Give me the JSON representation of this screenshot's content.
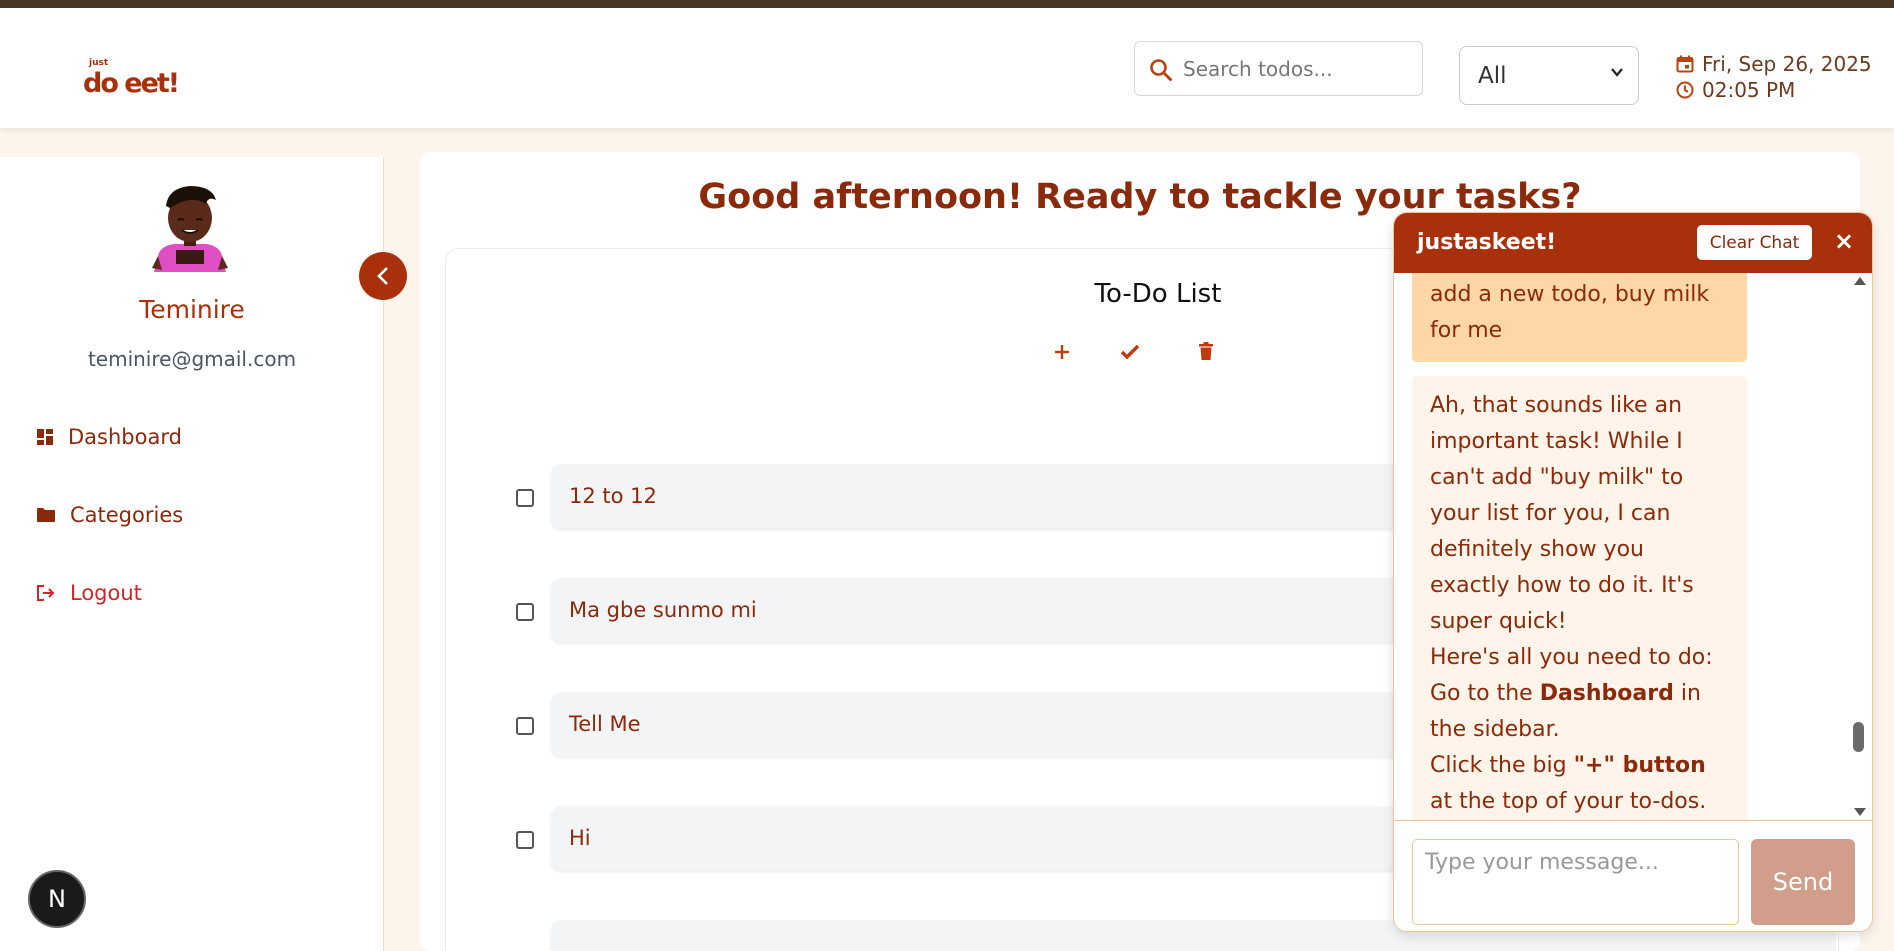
{
  "header": {
    "logo_small": "just",
    "logo_big": "do eet!",
    "search_placeholder": "Search todos...",
    "filter_value": "All",
    "date": "Fri, Sep 26, 2025",
    "time": "02:05 PM"
  },
  "sidebar": {
    "user_name": "Teminire",
    "user_email": "teminire@gmail.com",
    "items": [
      {
        "label": "Dashboard",
        "icon": "dashboard-icon"
      },
      {
        "label": "Categories",
        "icon": "folder-icon"
      },
      {
        "label": "Logout",
        "icon": "logout-icon"
      }
    ]
  },
  "main": {
    "greeting": "Good afternoon! Ready to tackle your tasks?",
    "list_title": "To-Do List",
    "todos": [
      {
        "text": "12 to 12",
        "checked": false
      },
      {
        "text": "Ma gbe sunmo mi",
        "checked": false
      },
      {
        "text": "Tell Me",
        "checked": false
      },
      {
        "text": "Hi",
        "checked": false
      }
    ]
  },
  "badge": "N",
  "chat": {
    "title": "justaskeet!",
    "clear_label": "Clear Chat",
    "close_label": "×",
    "user_message": "add a new todo, buy milk for me",
    "bot_message_1": "Ah, that sounds like an important task! While I can't add \"buy milk\" to your list for you, I can definitely show you exactly how to do it. It's super quick!",
    "bot_message_2": "Here's all you need to do:",
    "bot_message_3a": "Go to the ",
    "bot_message_3b": "Dashboard",
    "bot_message_3c": " in the sidebar.",
    "bot_message_4a": "Click the big ",
    "bot_message_4b": "\"+\" button",
    "bot_message_4c": " at the top of your to-dos.",
    "input_placeholder": "Type your message...",
    "send_label": "Send"
  },
  "colors": {
    "brand": "#a8300a",
    "text": "#8a2a0a",
    "background": "#fdf4ec",
    "logout": "#d1252a",
    "user_bubble": "#fdd7a8",
    "bot_bubble": "#fef4e9",
    "send_disabled": "#d29e8c"
  }
}
